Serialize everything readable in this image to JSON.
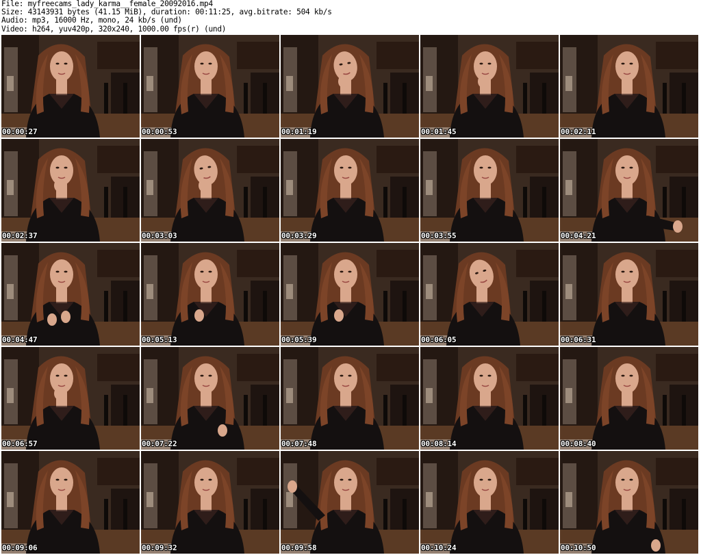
{
  "header": {
    "file_line": "File: myfreecams_lady_karma__female_20092016.mp4",
    "size_line": "Size: 43143931 bytes (41.15 MiB), duration: 00:11:25, avg.bitrate: 504 kb/s",
    "audio_line": "Audio: mp3, 16000 Hz, mono, 24 kb/s (und)",
    "video_line": "Video: h264, yuv420p, 320x240, 1000.00 fps(r) (und)"
  },
  "thumbnails": [
    {
      "timestamp": "00:00:27",
      "pose": "neutral"
    },
    {
      "timestamp": "00:00:53",
      "pose": "neutral"
    },
    {
      "timestamp": "00:01:19",
      "pose": "hand-face"
    },
    {
      "timestamp": "00:01:45",
      "pose": "hand-chin"
    },
    {
      "timestamp": "00:02:11",
      "pose": "neutral"
    },
    {
      "timestamp": "00:02:37",
      "pose": "hand-chin"
    },
    {
      "timestamp": "00:03:03",
      "pose": "hand-face"
    },
    {
      "timestamp": "00:03:29",
      "pose": "neutral"
    },
    {
      "timestamp": "00:03:55",
      "pose": "neutral"
    },
    {
      "timestamp": "00:04:21",
      "pose": "arm-out"
    },
    {
      "timestamp": "00:04:47",
      "pose": "hands-front"
    },
    {
      "timestamp": "00:05:13",
      "pose": "hand-chest"
    },
    {
      "timestamp": "00:05:39",
      "pose": "hand-chest"
    },
    {
      "timestamp": "00:06:05",
      "pose": "head-tilt"
    },
    {
      "timestamp": "00:06:31",
      "pose": "neutral"
    },
    {
      "timestamp": "00:06:57",
      "pose": "hand-chin"
    },
    {
      "timestamp": "00:07:22",
      "pose": "hand-front"
    },
    {
      "timestamp": "00:07:48",
      "pose": "neutral"
    },
    {
      "timestamp": "00:08:14",
      "pose": "neutral"
    },
    {
      "timestamp": "00:08:40",
      "pose": "neutral"
    },
    {
      "timestamp": "00:09:06",
      "pose": "neutral"
    },
    {
      "timestamp": "00:09:32",
      "pose": "neutral"
    },
    {
      "timestamp": "00:09:58",
      "pose": "arm-up"
    },
    {
      "timestamp": "00:10:24",
      "pose": "neutral"
    },
    {
      "timestamp": "00:10:50",
      "pose": "hand-hip"
    }
  ],
  "colors": {
    "background": "#ffffff",
    "header_text": "#000000",
    "timestamp_text": "#ffffff",
    "scene_wall": "#3a2a20",
    "scene_floor": "#5a3a24",
    "hair": "#6b3a22",
    "skin": "#d9a78c",
    "top": "#141010"
  }
}
